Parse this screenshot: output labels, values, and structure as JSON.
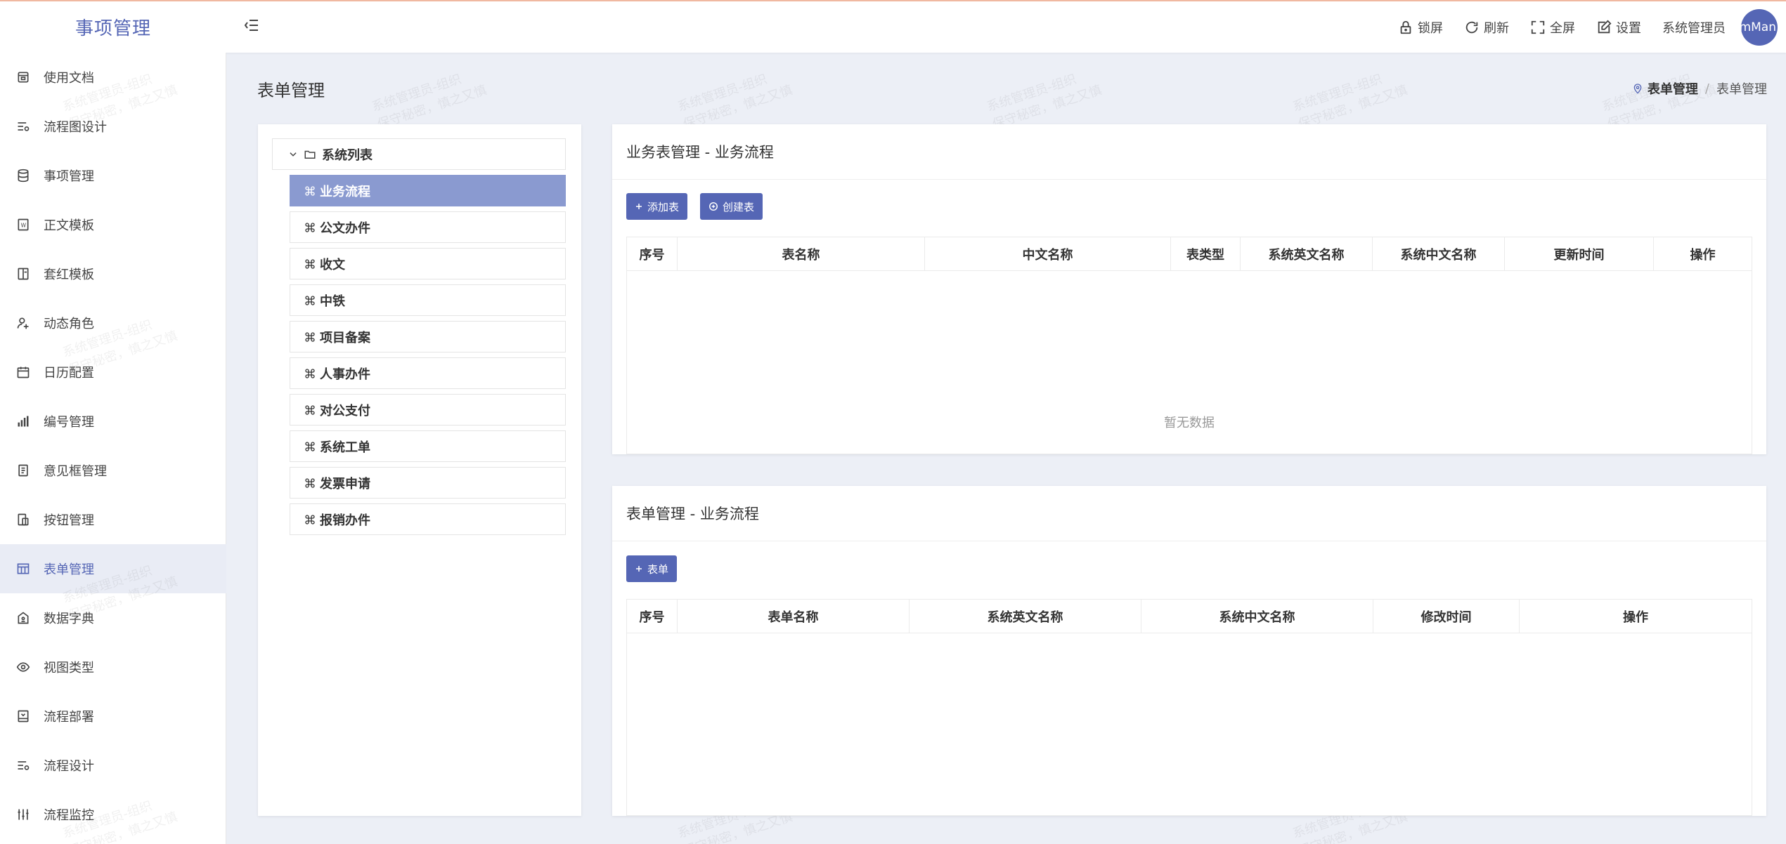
{
  "app": {
    "title": "事项管理"
  },
  "header": {
    "actions": [
      {
        "label": "锁屏",
        "icon": "lock-icon"
      },
      {
        "label": "刷新",
        "icon": "refresh-icon"
      },
      {
        "label": "全屏",
        "icon": "fullscreen-icon"
      },
      {
        "label": "设置",
        "icon": "settings-icon"
      }
    ],
    "user_name": "系统管理员",
    "avatar_text": "SystemMan"
  },
  "sidebar": {
    "items": [
      {
        "label": "使用文档",
        "icon": "document-icon"
      },
      {
        "label": "流程图设计",
        "icon": "flowchart-icon"
      },
      {
        "label": "事项管理",
        "icon": "database-icon"
      },
      {
        "label": "正文模板",
        "icon": "template-icon"
      },
      {
        "label": "套红模板",
        "icon": "red-template-icon"
      },
      {
        "label": "动态角色",
        "icon": "user-add-icon"
      },
      {
        "label": "日历配置",
        "icon": "calendar-icon"
      },
      {
        "label": "编号管理",
        "icon": "bar-chart-icon"
      },
      {
        "label": "意见框管理",
        "icon": "opinion-box-icon"
      },
      {
        "label": "按钮管理",
        "icon": "button-icon"
      },
      {
        "label": "表单管理",
        "icon": "table-icon",
        "active": true
      },
      {
        "label": "数据字典",
        "icon": "dictionary-icon"
      },
      {
        "label": "视图类型",
        "icon": "eye-icon"
      },
      {
        "label": "流程部署",
        "icon": "deploy-icon"
      },
      {
        "label": "流程设计",
        "icon": "flow-design-icon"
      },
      {
        "label": "流程监控",
        "icon": "monitor-icon"
      }
    ]
  },
  "page": {
    "title": "表单管理",
    "breadcrumb": {
      "current": "表单管理",
      "last": "表单管理"
    }
  },
  "tree": {
    "root": "系统列表",
    "nodes": [
      "业务流程",
      "公文办件",
      "收文",
      "中铁",
      "项目备案",
      "人事办件",
      "对公支付",
      "系统工单",
      "发票申请",
      "报销办件"
    ],
    "selected_index": 0
  },
  "business_table_card": {
    "title": "业务表管理 - 业务流程",
    "add_button": "添加表",
    "create_button": "创建表",
    "columns": [
      "序号",
      "表名称",
      "中文名称",
      "表类型",
      "系统英文名称",
      "系统中文名称",
      "更新时间",
      "操作"
    ],
    "empty_text": "暂无数据"
  },
  "form_card": {
    "title": "表单管理 - 业务流程",
    "add_button": "表单",
    "columns": [
      "序号",
      "表单名称",
      "系统英文名称",
      "系统中文名称",
      "修改时间",
      "操作"
    ]
  },
  "watermark": {
    "line1": "系统管理员-组织",
    "line2": "保守秘密，慎之又慎"
  },
  "colors": {
    "accent": "#5566b5",
    "selected_node": "#8a9ad0",
    "background": "#eceff6"
  }
}
